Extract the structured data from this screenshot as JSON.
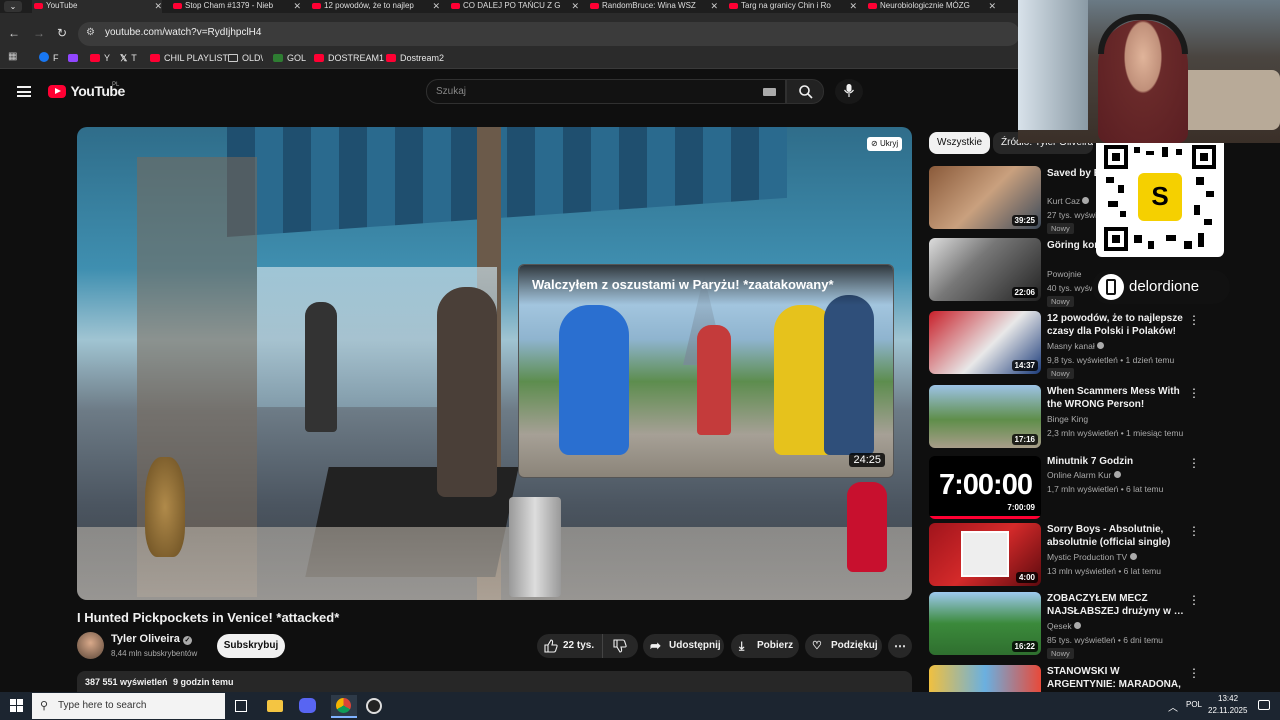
{
  "browser": {
    "tabs": [
      {
        "label": "YouTube"
      },
      {
        "label": "Stop Cham #1379 - Nieb"
      },
      {
        "label": "12 powodów, że to najlep"
      },
      {
        "label": "CO DALEJ PO TAŃCU Z G"
      },
      {
        "label": "RandomBruce: Wina WSZ"
      },
      {
        "label": "Targ na granicy Chin i Ro"
      },
      {
        "label": "Neurobiologicznie MÓZG"
      }
    ],
    "url": "youtube.com/watch?v=RydIjhpclH4",
    "bookmarks": [
      {
        "label": "F"
      },
      {
        "label": ""
      },
      {
        "label": "Y"
      },
      {
        "label": "T"
      },
      {
        "label": "CHIL PLAYLIST"
      },
      {
        "label": "OLD\\"
      },
      {
        "label": "GOL"
      },
      {
        "label": "DOSTREAM1"
      },
      {
        "label": "Dostream2"
      }
    ]
  },
  "youtube": {
    "logo": "YouTube",
    "country": "PL",
    "search_placeholder": "Szukaj"
  },
  "player": {
    "hide_label": "Ukryj",
    "endcard_title": "Walczyłem z oszustami w Paryżu! *zaatakowany*",
    "endcard_duration": "24:25"
  },
  "video": {
    "title": "I Hunted Pickpockets in Venice! *attacked*",
    "channel": "Tyler Oliveira",
    "subscribers": "8,44 mln subskrybentów",
    "subscribe_label": "Subskrybuj",
    "likes": "22 tys.",
    "share_label": "Udostępnij",
    "download_label": "Pobierz",
    "thanks_label": "Podziękuj",
    "views": "387 551 wyświetleń",
    "age": "9 godzin temu"
  },
  "chips": [
    {
      "label": "Wszystkie"
    },
    {
      "label": "Źródło: Tyler Oliveira"
    }
  ],
  "recommendations": [
    {
      "title": "Saved by E… Mancheste…",
      "channel": "Kurt Caz",
      "meta": "27 tys. wyświ…",
      "badge": "Nowy",
      "duration": "39:25"
    },
    {
      "title": "Göring kor… Najważnie…",
      "channel": "Powojnie",
      "meta": "40 tys. wyświ…",
      "badge": "Nowy",
      "duration": "22:06"
    },
    {
      "title": "12 powodów, że to najlepsze czasy dla Polski i Polaków!",
      "channel": "Masny kanał",
      "meta": "9,8 tys. wyświetleń • 1 dzień temu",
      "badge": "Nowy",
      "duration": "14:37"
    },
    {
      "title": "When Scammers Mess With the WRONG Person!",
      "channel": "Binge King",
      "meta": "2,3 mln wyświetleń • 1 miesiąc temu",
      "badge": "",
      "duration": "17:16"
    },
    {
      "title": "Minutnik 7 Godzin",
      "channel": "Online Alarm Kur",
      "meta": "1,7 mln wyświetleń • 6 lat temu",
      "badge": "",
      "duration": "7:00:09",
      "thumb_text": "7:00:00"
    },
    {
      "title": "Sorry Boys - Absolutnie, absolutnie (official single)",
      "channel": "Mystic Production TV",
      "meta": "13 mln wyświetleń • 6 lat temu",
      "badge": "",
      "duration": "4:00"
    },
    {
      "title": "ZOBACZYŁEM MECZ NAJSŁABSZEJ drużyny w …",
      "channel": "Qesek",
      "meta": "85 tys. wyświetleń • 6 dni temu",
      "badge": "Nowy",
      "duration": "16:22"
    },
    {
      "title": "STANOWSKI W ARGENTYNIE: MARADONA, TANGO, FUTBOL …",
      "channel": "",
      "meta": "",
      "badge": "",
      "duration": ""
    }
  ],
  "overlay": {
    "streamer": "delordione"
  },
  "taskbar": {
    "search_placeholder": "Type here to search",
    "lang": "POL",
    "time": "13:42",
    "date": "22.11.2025"
  }
}
